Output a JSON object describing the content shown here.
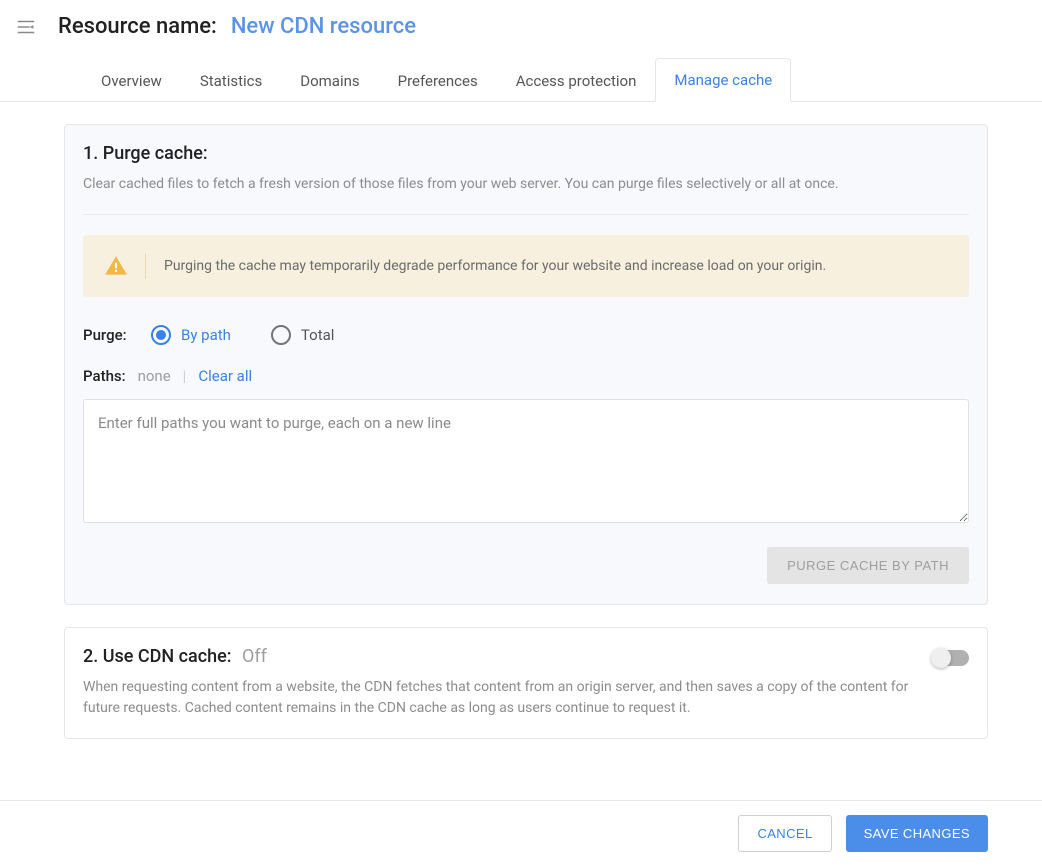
{
  "header": {
    "title_label": "Resource name:",
    "resource_name": "New CDN resource"
  },
  "tabs": [
    {
      "label": "Overview",
      "active": false
    },
    {
      "label": "Statistics",
      "active": false
    },
    {
      "label": "Domains",
      "active": false
    },
    {
      "label": "Preferences",
      "active": false
    },
    {
      "label": "Access protection",
      "active": false
    },
    {
      "label": "Manage cache",
      "active": true
    }
  ],
  "purge_section": {
    "title": "1. Purge cache:",
    "description": "Clear cached files to fetch a fresh version of those files from your web server. You can purge files selectively or all at once.",
    "warning": "Purging the cache may temporarily degrade performance for your website and increase load on your origin.",
    "purge_label": "Purge:",
    "radio_options": [
      {
        "label": "By path",
        "selected": true
      },
      {
        "label": "Total",
        "selected": false
      }
    ],
    "paths_label": "Paths:",
    "paths_value": "none",
    "clear_all_label": "Clear all",
    "textarea_placeholder": "Enter full paths you want to purge, each on a new line",
    "purge_button_label": "PURGE CACHE BY PATH"
  },
  "cdn_section": {
    "title": "2. Use CDN cache:",
    "status": "Off",
    "toggle_on": false,
    "description": "When requesting content from a website, the CDN fetches that content from an origin server, and then saves a copy of the content for future requests. Cached content remains in the CDN cache as long as users continue to request it."
  },
  "footer": {
    "cancel_label": "CANCEL",
    "save_label": "SAVE CHANGES"
  }
}
